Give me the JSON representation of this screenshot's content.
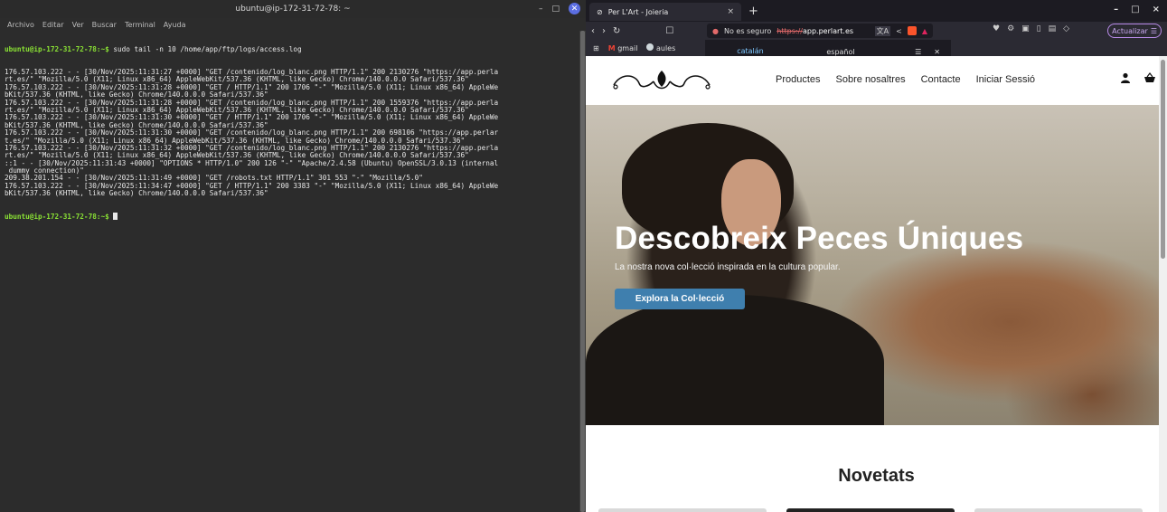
{
  "terminal": {
    "title": "ubuntu@ip-172-31-72-78: ~",
    "controls": {
      "minimize": "–",
      "maximize": "□",
      "close": "✕"
    },
    "menu": [
      "Archivo",
      "Editar",
      "Ver",
      "Buscar",
      "Terminal",
      "Ayuda"
    ],
    "prompt": "ubuntu@ip-172-31-72-78:~$",
    "command": " sudo tail -n 10 /home/app/ftp/logs/access.log",
    "lines": [
      "176.57.103.222 - - [30/Nov/2025:11:31:27 +0000] \"GET /contenido/log_blanc.png HTTP/1.1\" 200 2130276 \"https://app.perla",
      "rt.es/\" \"Mozilla/5.0 (X11; Linux x86_64) AppleWebKit/537.36 (KHTML, like Gecko) Chrome/140.0.0.0 Safari/537.36\"",
      "176.57.103.222 - - [30/Nov/2025:11:31:28 +0000] \"GET / HTTP/1.1\" 200 1706 \"-\" \"Mozilla/5.0 (X11; Linux x86_64) AppleWe",
      "bKit/537.36 (KHTML, like Gecko) Chrome/140.0.0.0 Safari/537.36\"",
      "176.57.103.222 - - [30/Nov/2025:11:31:28 +0000] \"GET /contenido/log_blanc.png HTTP/1.1\" 200 1559376 \"https://app.perla",
      "rt.es/\" \"Mozilla/5.0 (X11; Linux x86_64) AppleWebKit/537.36 (KHTML, like Gecko) Chrome/140.0.0.0 Safari/537.36\"",
      "176.57.103.222 - - [30/Nov/2025:11:31:30 +0000] \"GET / HTTP/1.1\" 200 1706 \"-\" \"Mozilla/5.0 (X11; Linux x86_64) AppleWe",
      "bKit/537.36 (KHTML, like Gecko) Chrome/140.0.0.0 Safari/537.36\"",
      "176.57.103.222 - - [30/Nov/2025:11:31:30 +0000] \"GET /contenido/log_blanc.png HTTP/1.1\" 200 698106 \"https://app.perlar",
      "t.es/\" \"Mozilla/5.0 (X11; Linux x86_64) AppleWebKit/537.36 (KHTML, like Gecko) Chrome/140.0.0.0 Safari/537.36\"",
      "176.57.103.222 - - [30/Nov/2025:11:31:32 +0000] \"GET /contenido/log_blanc.png HTTP/1.1\" 200 2130276 \"https://app.perla",
      "rt.es/\" \"Mozilla/5.0 (X11; Linux x86_64) AppleWebKit/537.36 (KHTML, like Gecko) Chrome/140.0.0.0 Safari/537.36\"",
      "::1 - - [30/Nov/2025:11:31:43 +0000] \"OPTIONS * HTTP/1.0\" 200 126 \"-\" \"Apache/2.4.58 (Ubuntu) OpenSSL/3.0.13 (internal",
      " dummy connection)\"",
      "209.38.201.154 - - [30/Nov/2025:11:31:49 +0000] \"GET /robots.txt HTTP/1.1\" 301 553 \"-\" \"Mozilla/5.0\"",
      "176.57.103.222 - - [30/Nov/2025:11:34:47 +0000] \"GET / HTTP/1.1\" 200 3383 \"-\" \"Mozilla/5.0 (X11; Linux x86_64) AppleWe",
      "bKit/537.36 (KHTML, like Gecko) Chrome/140.0.0.0 Safari/537.36\""
    ],
    "final_prompt": "ubuntu@ip-172-31-72-78:~$",
    "colors": {
      "prompt": "#8ae234",
      "background": "#2c2c2c"
    }
  },
  "browser": {
    "tab_title": "Per L'Art - Joieria",
    "tab_close": "×",
    "new_tab": "+",
    "window_controls": {
      "minimize": "–",
      "maximize": "□",
      "close": "×"
    },
    "nav": {
      "back": "‹",
      "forward": "›",
      "reload": "↻",
      "bookmark": "☐"
    },
    "security_label": "No es seguro",
    "url_scheme": "https://",
    "url_host": "app.perlart.es",
    "update_label": "Actualizar",
    "bookmarks": [
      {
        "label": "gmail",
        "icon": "gmail-icon"
      },
      {
        "label": "aules",
        "icon": "aules-icon"
      }
    ],
    "translate": {
      "languages": [
        "catalán",
        "español"
      ],
      "active": "catalán"
    }
  },
  "site": {
    "nav": [
      "Productes",
      "Sobre nosaltres",
      "Contacte",
      "Iniciar Sessió"
    ],
    "hero": {
      "title": "Descobreix Peces Úniques",
      "subtitle": "La nostra nova col·lecció inspirada en la cultura popular.",
      "cta": "Explora la Col·lecció"
    },
    "section_title": "Novetats",
    "colors": {
      "cta": "#3f7fae",
      "text": "#222222"
    }
  }
}
